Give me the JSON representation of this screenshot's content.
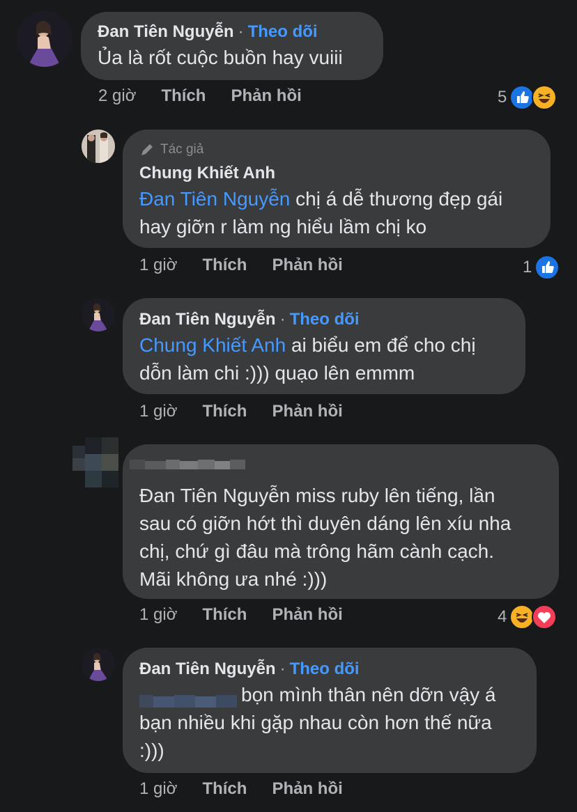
{
  "comments": [
    {
      "author": "Đan Tiên Nguyễn",
      "follow": "Theo dõi",
      "text": "Ủa là rốt cuộc buồn hay vuiii",
      "time": "2 giờ",
      "like": "Thích",
      "reply": "Phản hồi",
      "reaction_count": "5",
      "reactions": [
        "like-icon",
        "haha-icon"
      ]
    },
    {
      "badge": "Tác giả",
      "author": "Chung Khiết Anh",
      "mention": "Đan Tiên Nguyễn",
      "text_line1": " chị á dễ thương đẹp gái",
      "text_line2": "hay giỡn r làm ng hiểu lầm chị ko",
      "time": "1 giờ",
      "like": "Thích",
      "reply": "Phản hồi",
      "reaction_count": "1",
      "reactions": [
        "like-icon"
      ]
    },
    {
      "author": "Đan Tiên Nguyễn",
      "follow": "Theo dõi",
      "mention": "Chung Khiết Anh",
      "text_line1": " ai biểu em để cho chị",
      "text_line2": "dỗn làm chi :))) quạo lên emmm",
      "time": "1 giờ",
      "like": "Thích",
      "reply": "Phản hồi"
    },
    {
      "text_line1": "Đan Tiên Nguyễn miss ruby lên tiếng, lần",
      "text_line2": "sau có giỡn hớt thì duyên dáng lên xíu nha",
      "text_line3": "chị, chứ gì đâu mà trông hãm cành cạch.",
      "text_line4": "Mãi không ưa nhé :)))",
      "time": "1 giờ",
      "like": "Thích",
      "reply": "Phản hồi",
      "reaction_count": "4",
      "reactions": [
        "haha-icon",
        "love-icon"
      ]
    },
    {
      "author": "Đan Tiên Nguyễn",
      "follow": "Theo dõi",
      "text_line1": "bọn mình thân nên dỡn vậy á",
      "text_line2": "bạn nhiều khi gặp nhau còn hơn thế nữa",
      "text_line3": ":)))",
      "time": "1 giờ",
      "like": "Thích",
      "reply": "Phản hồi"
    }
  ],
  "colors": {
    "background": "#18191a",
    "bubble": "#3a3b3c",
    "link": "#4599ff",
    "muted": "#b0b3b8"
  }
}
